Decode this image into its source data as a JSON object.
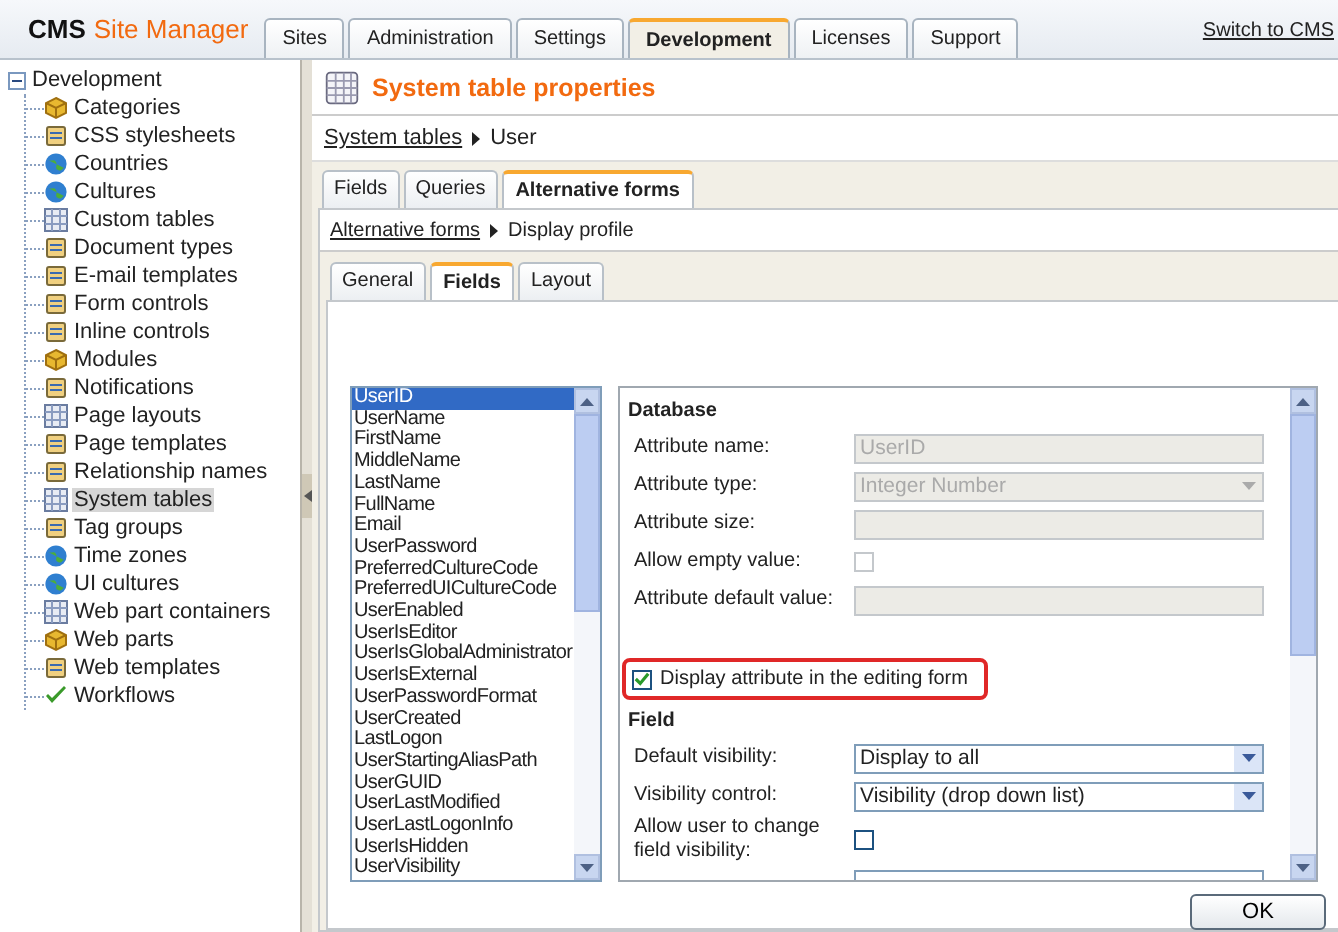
{
  "header": {
    "logo_bold": "CMS",
    "logo_rest": "Site Manager",
    "switch_link": "Switch to CMS",
    "tabs": [
      {
        "label": "Sites",
        "selected": false
      },
      {
        "label": "Administration",
        "selected": false
      },
      {
        "label": "Settings",
        "selected": false
      },
      {
        "label": "Development",
        "selected": true
      },
      {
        "label": "Licenses",
        "selected": false
      },
      {
        "label": "Support",
        "selected": false
      }
    ]
  },
  "sidebar": {
    "root": {
      "label": "Development",
      "expanded": true,
      "children": [
        {
          "label": "Categories",
          "selected": false
        },
        {
          "label": "CSS stylesheets",
          "selected": false
        },
        {
          "label": "Countries",
          "selected": false
        },
        {
          "label": "Cultures",
          "selected": false
        },
        {
          "label": "Custom tables",
          "selected": false
        },
        {
          "label": "Document types",
          "selected": false
        },
        {
          "label": "E-mail templates",
          "selected": false
        },
        {
          "label": "Form controls",
          "selected": false
        },
        {
          "label": "Inline controls",
          "selected": false
        },
        {
          "label": "Modules",
          "selected": false
        },
        {
          "label": "Notifications",
          "selected": false
        },
        {
          "label": "Page layouts",
          "selected": false
        },
        {
          "label": "Page templates",
          "selected": false
        },
        {
          "label": "Relationship names",
          "selected": false
        },
        {
          "label": "System tables",
          "selected": true
        },
        {
          "label": "Tag groups",
          "selected": false
        },
        {
          "label": "Time zones",
          "selected": false
        },
        {
          "label": "UI cultures",
          "selected": false
        },
        {
          "label": "Web part containers",
          "selected": false
        },
        {
          "label": "Web parts",
          "selected": false
        },
        {
          "label": "Web templates",
          "selected": false
        },
        {
          "label": "Workflows",
          "selected": false
        }
      ]
    }
  },
  "page": {
    "title": "System table properties",
    "breadcrumb": {
      "link": "System tables",
      "current": "User"
    },
    "tabs": [
      {
        "label": "Fields",
        "selected": false
      },
      {
        "label": "Queries",
        "selected": false
      },
      {
        "label": "Alternative forms",
        "selected": true
      }
    ],
    "sub_breadcrumb": {
      "link": "Alternative forms",
      "current": "Display profile"
    },
    "sub_tabs": [
      {
        "label": "General",
        "selected": false
      },
      {
        "label": "Fields",
        "selected": true
      },
      {
        "label": "Layout",
        "selected": false
      }
    ],
    "attributes": [
      {
        "label": "UserID",
        "selected": true
      },
      {
        "label": "UserName",
        "selected": false
      },
      {
        "label": "FirstName",
        "selected": false
      },
      {
        "label": "MiddleName",
        "selected": false
      },
      {
        "label": "LastName",
        "selected": false
      },
      {
        "label": "FullName",
        "selected": false
      },
      {
        "label": "Email",
        "selected": false
      },
      {
        "label": "UserPassword",
        "selected": false
      },
      {
        "label": "PreferredCultureCode",
        "selected": false
      },
      {
        "label": "PreferredUICultureCode",
        "selected": false
      },
      {
        "label": "UserEnabled",
        "selected": false
      },
      {
        "label": "UserIsEditor",
        "selected": false
      },
      {
        "label": "UserIsGlobalAdministrator",
        "selected": false
      },
      {
        "label": "UserIsExternal",
        "selected": false
      },
      {
        "label": "UserPasswordFormat",
        "selected": false
      },
      {
        "label": "UserCreated",
        "selected": false
      },
      {
        "label": "LastLogon",
        "selected": false
      },
      {
        "label": "UserStartingAliasPath",
        "selected": false
      },
      {
        "label": "UserGUID",
        "selected": false
      },
      {
        "label": "UserLastModified",
        "selected": false
      },
      {
        "label": "UserLastLogonInfo",
        "selected": false
      },
      {
        "label": "UserIsHidden",
        "selected": false
      },
      {
        "label": "UserVisibility",
        "selected": false
      }
    ],
    "database": {
      "heading": "Database",
      "rows": [
        {
          "kind": "text",
          "label": "Attribute name:",
          "value": "UserID",
          "disabled": true
        },
        {
          "kind": "select",
          "label": "Attribute type:",
          "value": "Integer Number",
          "disabled": true
        },
        {
          "kind": "text",
          "label": "Attribute size:",
          "disabled": true
        },
        {
          "kind": "checkbox",
          "label": "Allow empty value:",
          "checked": false,
          "disabled": true
        },
        {
          "kind": "text",
          "label": "Attribute default value:",
          "disabled": true
        }
      ]
    },
    "display_checkbox": {
      "label": "Display attribute in the editing form",
      "checked": true,
      "highlighted": true
    },
    "field": {
      "heading": "Field",
      "rows": [
        {
          "kind": "select",
          "label": "Default visibility:",
          "value": "Display to all",
          "disabled": false
        },
        {
          "kind": "select",
          "label": "Visibility control:",
          "value": "Visibility (drop down list)",
          "disabled": false
        },
        {
          "kind": "checkbox",
          "label": "Allow user to change field visibility:",
          "checked": false,
          "disabled": false
        },
        {
          "kind": "text",
          "disabled": false
        }
      ]
    },
    "ok_button": "OK"
  }
}
